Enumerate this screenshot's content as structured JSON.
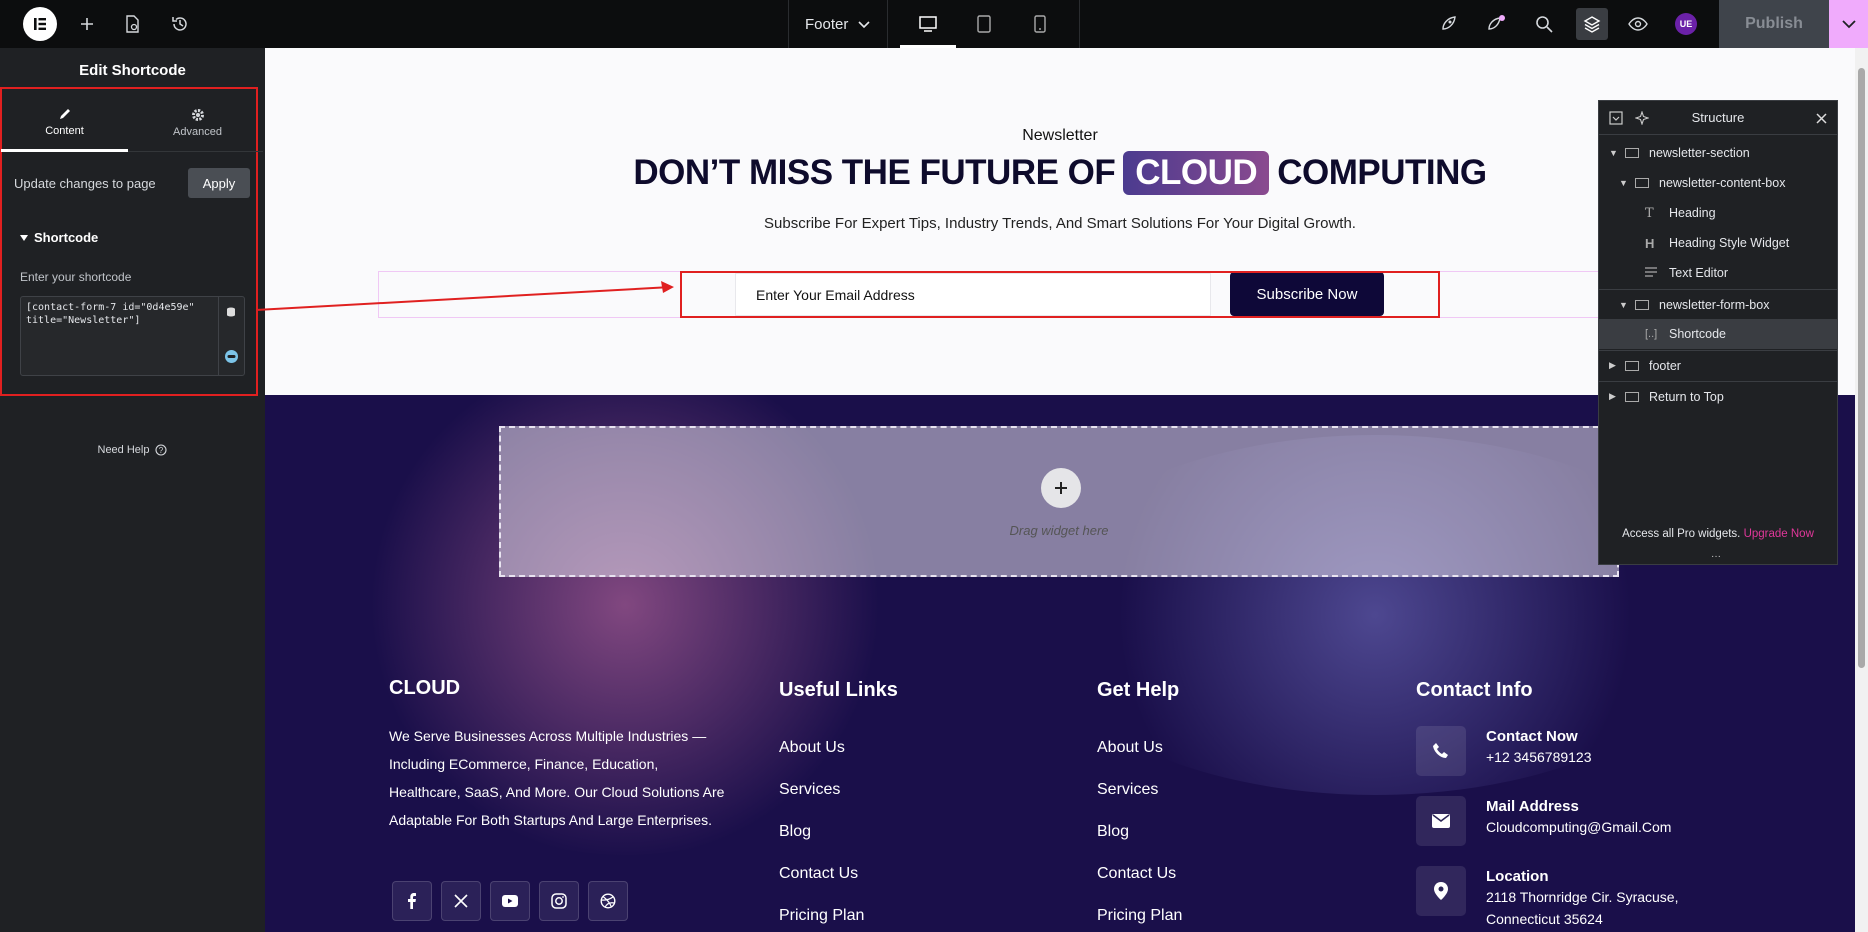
{
  "topbar": {
    "document_label": "Footer",
    "publish_label": "Publish",
    "avatar_initials": "UE"
  },
  "panel": {
    "title": "Edit Shortcode",
    "tabs": [
      {
        "label": "Content"
      },
      {
        "label": "Advanced"
      }
    ],
    "update_text": "Update changes to page",
    "apply_label": "Apply",
    "section_label": "Shortcode",
    "field_label": "Enter your shortcode",
    "shortcode_value": "[contact-form-7 id=\"0d4e59e\" title=\"Newsletter\"]",
    "need_help": "Need Help"
  },
  "newsletter": {
    "eyebrow": "Newsletter",
    "heading_pre": "DON’T MISS THE FUTURE OF",
    "heading_highlight": "CLOUD",
    "heading_post": "COMPUTING",
    "subtitle": "Subscribe For Expert Tips, Industry Trends, And Smart Solutions For Your Digital Growth.",
    "email_placeholder": "Enter Your Email Address",
    "subscribe_label": "Subscribe Now"
  },
  "dropzone": {
    "text": "Drag widget here"
  },
  "footer": {
    "brand": "CLOUD",
    "about": "We Serve Businesses Across Multiple Industries — Including ECommerce, Finance, Education, Healthcare, SaaS, And More. Our Cloud Solutions Are Adaptable For Both Startups And Large Enterprises.",
    "useful_links": {
      "title": "Useful Links",
      "items": [
        "About Us",
        "Services",
        "Blog",
        "Contact Us",
        "Pricing Plan"
      ]
    },
    "get_help": {
      "title": "Get Help",
      "items": [
        "About Us",
        "Services",
        "Blog",
        "Contact Us",
        "Pricing Plan"
      ]
    },
    "contact": {
      "title": "Contact Info",
      "phone_title": "Contact Now",
      "phone": "+12 3456789123",
      "mail_title": "Mail Address",
      "mail": "Cloudcomputing@Gmail.Com",
      "loc_title": "Location",
      "loc_line1": "2118 Thornridge Cir. Syracuse,",
      "loc_line2": "Connecticut 35624"
    }
  },
  "structure": {
    "title": "Structure",
    "items": [
      {
        "label": "newsletter-section"
      },
      {
        "label": "newsletter-content-box"
      },
      {
        "label": "Heading"
      },
      {
        "label": "Heading Style Widget"
      },
      {
        "label": "Text Editor"
      },
      {
        "label": "newsletter-form-box"
      },
      {
        "label": "Shortcode"
      },
      {
        "label": "footer"
      },
      {
        "label": "Return to Top"
      }
    ],
    "promo_text": "Access all Pro widgets.",
    "promo_link": "Upgrade Now"
  },
  "colors": {
    "accent_pink": "#f0abfc",
    "footer_bg": "#1a0f4a",
    "subscribe_bg": "#0e0838",
    "annotation_red": "#e02020"
  }
}
